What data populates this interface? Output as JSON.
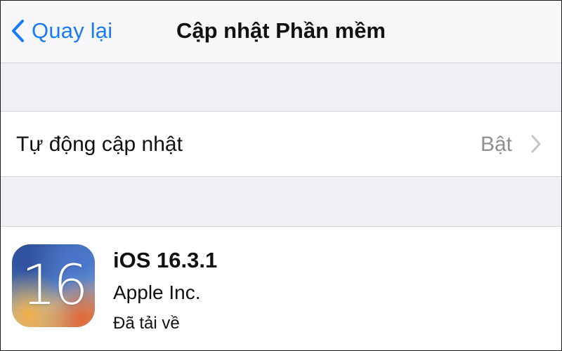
{
  "navbar": {
    "back_label": "Quay lại",
    "title": "Cập nhật Phần mềm"
  },
  "auto_update": {
    "label": "Tự động cập nhật",
    "value": "Bật"
  },
  "update": {
    "icon_text": "16",
    "title": "iOS 16.3.1",
    "vendor": "Apple Inc.",
    "status": "Đã tải về"
  },
  "colors": {
    "accent": "#1a7cf5",
    "secondary_text": "#8e8e93",
    "grouped_background": "#efeff4"
  }
}
